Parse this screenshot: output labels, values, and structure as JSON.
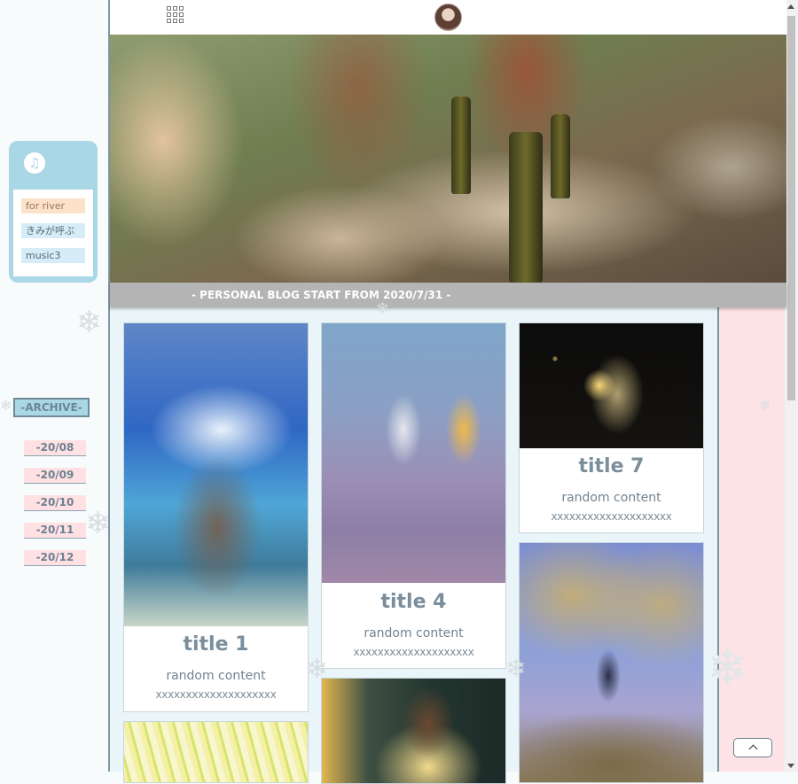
{
  "music": {
    "tracks": [
      "for river",
      "きみが呼ぶ",
      "music3"
    ]
  },
  "archive": {
    "label": "-ARCHIVE-",
    "items": [
      "-20/08",
      "-20/09",
      "-20/10",
      "-20/11",
      "-20/12"
    ]
  },
  "banner": {
    "caption": "- PERSONAL BLOG START FROM 2020/7/31 -"
  },
  "cards": [
    {
      "title": "title 1",
      "content": "random content",
      "xx": "xxxxxxxxxxxxxxxxxxxx"
    },
    {
      "title": "title 4",
      "content": "random content",
      "xx": "xxxxxxxxxxxxxxxxxxxx"
    },
    {
      "title": "title 7",
      "content": "random content",
      "xx": "xxxxxxxxxxxxxxxxxxxx"
    }
  ],
  "colors": {
    "sidebar_card": "#a9d7e5",
    "archive_item_bg": "#ffe1e4",
    "right_strip": "#fde3e6",
    "main_bg": "#eaf5fa"
  },
  "icons": [
    "music-note-icon",
    "grid-menu-icon",
    "avatar",
    "chevron-up-icon",
    "snowflake-icon"
  ]
}
